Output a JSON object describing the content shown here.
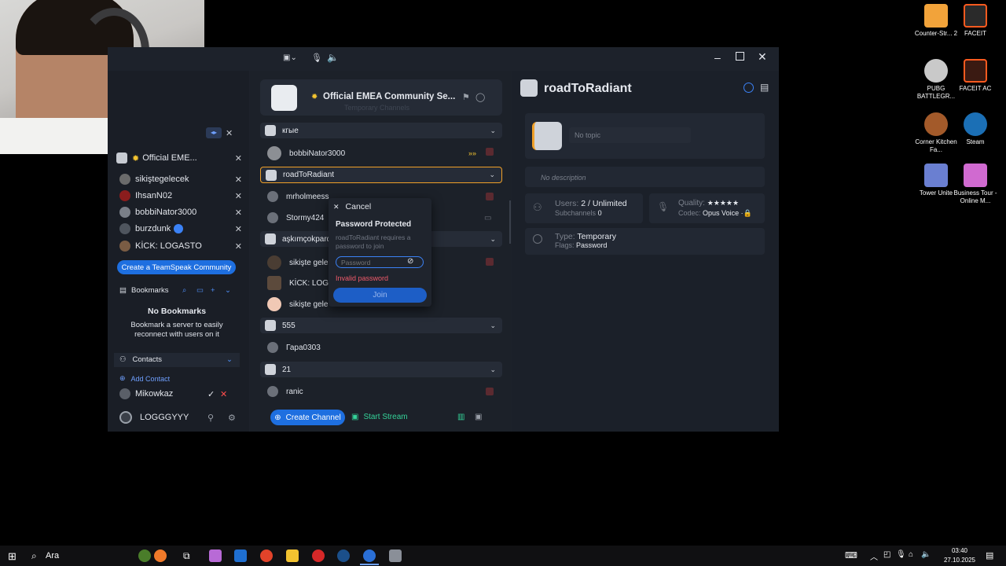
{
  "desktop_icons": [
    {
      "label": "Counter-Str... 2",
      "color": "#f2a33a"
    },
    {
      "label": "FACEIT",
      "color": "#ff5a1f"
    },
    {
      "label": "PUBG BATTLEGR...",
      "color": "#c9c9c9"
    },
    {
      "label": "FACEIT AC",
      "color": "#ff5a1f"
    },
    {
      "label": "Corner Kitchen Fa...",
      "color": "#a35a2a"
    },
    {
      "label": "Steam",
      "color": "#1b6fb5"
    },
    {
      "label": "Tower Unite",
      "color": "#6a7fd1"
    },
    {
      "label": "Business Tour - Online M...",
      "color": "#d06ad0"
    }
  ],
  "sidebar": {
    "server_name": "Official EME...",
    "clients": [
      {
        "name": "sikiştegelecek"
      },
      {
        "name": "IhsanN02"
      },
      {
        "name": "bobbiNator3000"
      },
      {
        "name": "burzdunk"
      },
      {
        "name": "KİCK: LOGASTO"
      }
    ],
    "create_community": "Create a TeamSpeak Community",
    "bookmarks_title": "Bookmarks",
    "no_bookmarks": "No Bookmarks",
    "bookmark_hint": "Bookmark a server to easily reconnect with users on it",
    "contacts_title": "Contacts",
    "add_contact": "Add Contact",
    "contact": "Mikowkaz",
    "self_name": "LOGGGYYY"
  },
  "server": {
    "name": "Official EMEA Community Se...",
    "subtitle": "Temporary Channels"
  },
  "channels": {
    "c1": "кгые",
    "c1_user": "bobbiNator3000",
    "c2": "roadToRadiant",
    "c2_users": [
      "mrholmeess",
      "Stormy424"
    ],
    "c3": "aşkımçokpardo",
    "c3_users": [
      "sikişte gele",
      "KİCK: LOGA",
      "sikişte gele"
    ],
    "c4": "555",
    "c4_user": "Гара0303",
    "c5": "21",
    "c5_user": "ranic"
  },
  "footer": {
    "create_channel": "Create Channel",
    "start_stream": "Start Stream"
  },
  "dialog": {
    "cancel": "Cancel",
    "title": "Password Protected",
    "message": "roadToRadiant requires a password to join",
    "placeholder": "Password",
    "error": "Invalid password",
    "join": "Join"
  },
  "channel_info": {
    "title": "roadToRadiant",
    "topic": "No topic",
    "description": "No description",
    "users_label": "Users:",
    "users_value": "2 / Unlimited",
    "subchannels_label": "Subchannels",
    "subchannels_value": "0",
    "quality_label": "Quality:",
    "quality_value": "★★★★★",
    "codec_label": "Codec:",
    "codec_value": "Opus Voice",
    "type_label": "Type:",
    "type_value": "Temporary",
    "flags_label": "Flags:",
    "flags_value": "Password"
  },
  "taskbar": {
    "search": "Ara",
    "time": "03:40",
    "date": "27.10.2025"
  }
}
